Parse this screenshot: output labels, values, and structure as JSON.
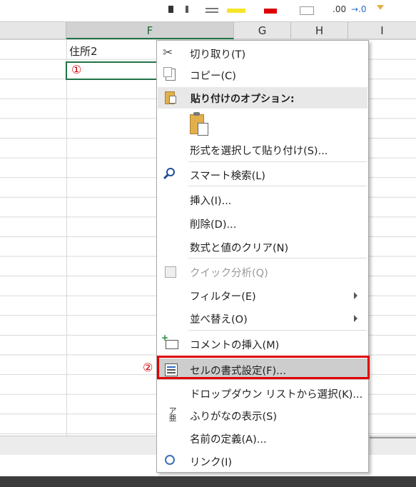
{
  "toolbar": {
    "decimal_increase": ".00",
    "decimal_decrease": "→.0"
  },
  "columns": [
    "F",
    "G",
    "H",
    "I"
  ],
  "cell": {
    "f1_value": "住所2",
    "marker1": "①"
  },
  "menu": {
    "cut": "切り取り(T)",
    "copy": "コピー(C)",
    "paste_options_header": "貼り付けのオプション:",
    "paste_special": "形式を選択して貼り付け(S)...",
    "smart_lookup": "スマート検索(L)",
    "insert": "挿入(I)...",
    "delete": "削除(D)...",
    "clear_contents": "数式と値のクリア(N)",
    "quick_analysis": "クイック分析(Q)",
    "filter": "フィルター(E)",
    "sort": "並べ替え(O)",
    "insert_comment": "コメントの挿入(M)",
    "format_cells": "セルの書式設定(F)...",
    "pick_from_list": "ドロップダウン リストから選択(K)...",
    "show_phonetic": "ふりがなの表示(S)",
    "define_name": "名前の定義(A)...",
    "link": "リンク(I)"
  },
  "annotation": {
    "marker2": "②"
  },
  "colors": {
    "excel_green": "#217346",
    "highlight_red": "#e00000",
    "paste_icon_gold": "#e2b04a"
  },
  "icons": [
    "cut-icon",
    "copy-icon",
    "paste-icon",
    "paste-option-icon",
    "smart-lookup-icon",
    "quick-analysis-icon",
    "insert-comment-icon",
    "format-cells-icon",
    "phonetic-icon",
    "link-icon"
  ]
}
